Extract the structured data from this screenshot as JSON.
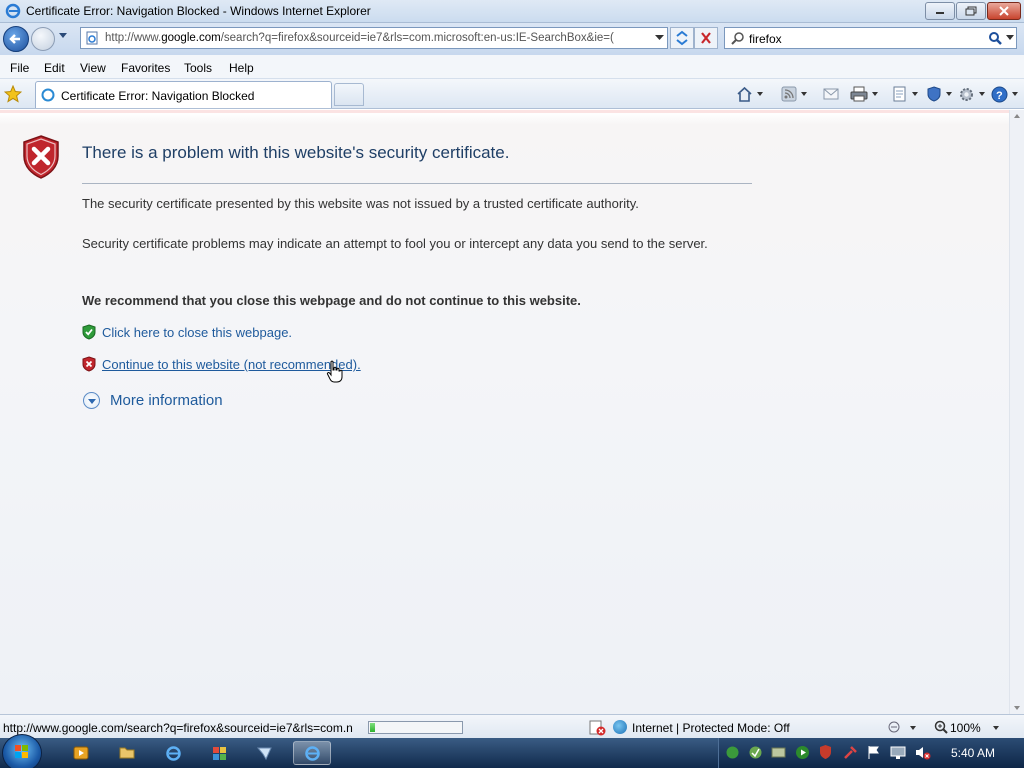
{
  "window": {
    "title": "Certificate Error: Navigation Blocked - Windows Internet Explorer"
  },
  "address_bar": {
    "url_prefix": "http://www.",
    "url_domain": "google.com",
    "url_rest": "/search?q=firefox&sourceid=ie7&rls=com.microsoft:en-us:IE-SearchBox&ie=("
  },
  "search": {
    "value": "firefox"
  },
  "menu": [
    "File",
    "Edit",
    "View",
    "Favorites",
    "Tools",
    "Help"
  ],
  "tab": {
    "title": "Certificate Error: Navigation Blocked"
  },
  "page": {
    "heading": "There is a problem with this website's security certificate.",
    "paragraph1": "The security certificate presented by this website was not issued by a trusted certificate authority.",
    "paragraph2": "Security certificate problems may indicate an attempt to fool you or intercept any data you send to the server.",
    "recommendation": "We recommend that you close this webpage and do not continue to this website.",
    "close_link": "Click here to close this webpage.",
    "continue_link": "Continue to this website (not recommended).",
    "more_info": "More information"
  },
  "status_bar": {
    "url": "http://www.google.com/search?q=firefox&sourceid=ie7&rls=com.n",
    "progress": 0.05,
    "zone": "Internet | Protected Mode: Off",
    "zoom": "100%"
  },
  "taskbar": {
    "clock": "5:40 AM"
  },
  "colors": {
    "link": "#1e5a9c",
    "heading": "#1f3f66",
    "danger_shield": "#c0262d",
    "safe_shield": "#2e9b3a"
  }
}
